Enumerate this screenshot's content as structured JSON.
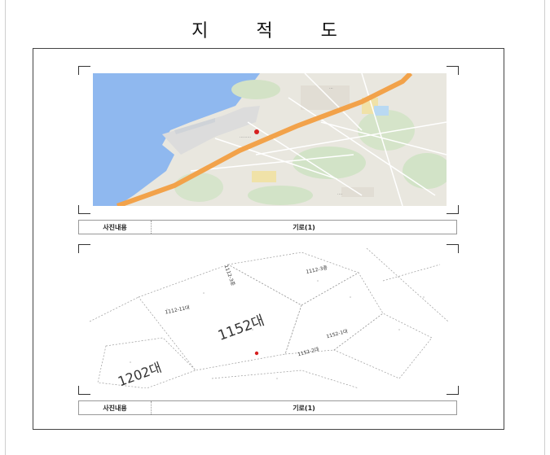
{
  "document": {
    "title": "지 적 도"
  },
  "panels": [
    {
      "caption_label": "사진내용",
      "caption_value": "기로(1)"
    },
    {
      "caption_label": "사진내용",
      "caption_value": "기로(1)"
    }
  ],
  "cadastral": {
    "lot_major_1": "1152대",
    "lot_major_2": "1202대",
    "lot_small_1": "1112-11대",
    "lot_small_2": "1112-3종",
    "lot_small_3": "1112-3종",
    "lot_small_4": "1152-1대",
    "lot_small_5": "1152-2대"
  },
  "colors": {
    "sea": "#8fb8ef",
    "road": "#f2a24a",
    "land": "#e9e7df",
    "marker": "#d62020"
  }
}
